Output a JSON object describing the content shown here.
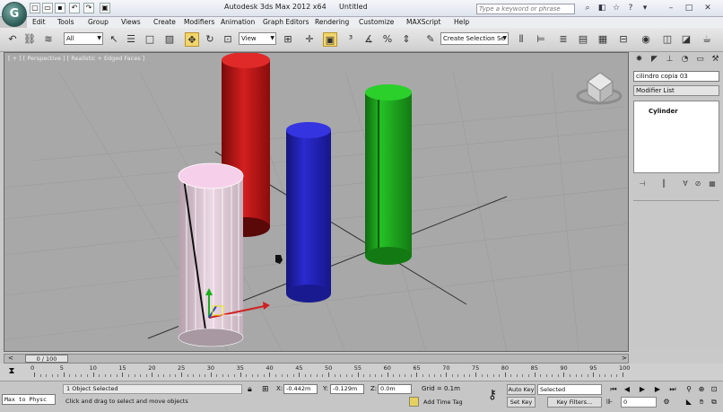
{
  "titlebar": {
    "app_title": "Autodesk 3ds Max  2012 x64",
    "document": "Untitled",
    "search_placeholder": "Type a keyword or phrase",
    "logo_letter": "G"
  },
  "menu": [
    "Edit",
    "Tools",
    "Group",
    "Views",
    "Create",
    "Modifiers",
    "Animation",
    "Graph Editors",
    "Rendering",
    "Customize",
    "MAXScript",
    "Help"
  ],
  "toolbar": {
    "filter_value": "All",
    "refcoord_value": "View",
    "named_selection_placeholder": "Create Selection Se"
  },
  "viewport": {
    "label": "[ + ] [ Perspective ] [ Realistic + Edged Faces ]",
    "objects": [
      {
        "name": "red-cylinder",
        "color": "#cc1a1a"
      },
      {
        "name": "blue-cylinder",
        "color": "#2222b8"
      },
      {
        "name": "green-cylinder",
        "color": "#1fa31f"
      },
      {
        "name": "pink-cylinder",
        "color": "#f0c8dc"
      }
    ]
  },
  "command_panel": {
    "object_name": "cilindro copia 03",
    "modifier_list": "Modifier List",
    "stack_item": "Cylinder"
  },
  "timeline": {
    "slider_label": "0 / 100",
    "ticks": [
      "0",
      "5",
      "10",
      "15",
      "20",
      "25",
      "30",
      "35",
      "40",
      "45",
      "50",
      "55",
      "60",
      "65",
      "70",
      "75",
      "80",
      "85",
      "90",
      "95",
      "100"
    ]
  },
  "status": {
    "maxscript": "Max to Physc",
    "selection": "1 Object Selected",
    "prompt": "Click and drag to select and move objects",
    "x_label": "X:",
    "x_value": "-0.442m",
    "y_label": "Y:",
    "y_value": "-0.129m",
    "z_label": "Z:",
    "z_value": "0.0m",
    "grid": "Grid = 0.1m",
    "add_time_tag": "Add Time Tag",
    "auto_key": "Auto Key",
    "set_key": "Set Key",
    "selected": "Selected",
    "key_filters": "Key Filters...",
    "frame": "0"
  }
}
